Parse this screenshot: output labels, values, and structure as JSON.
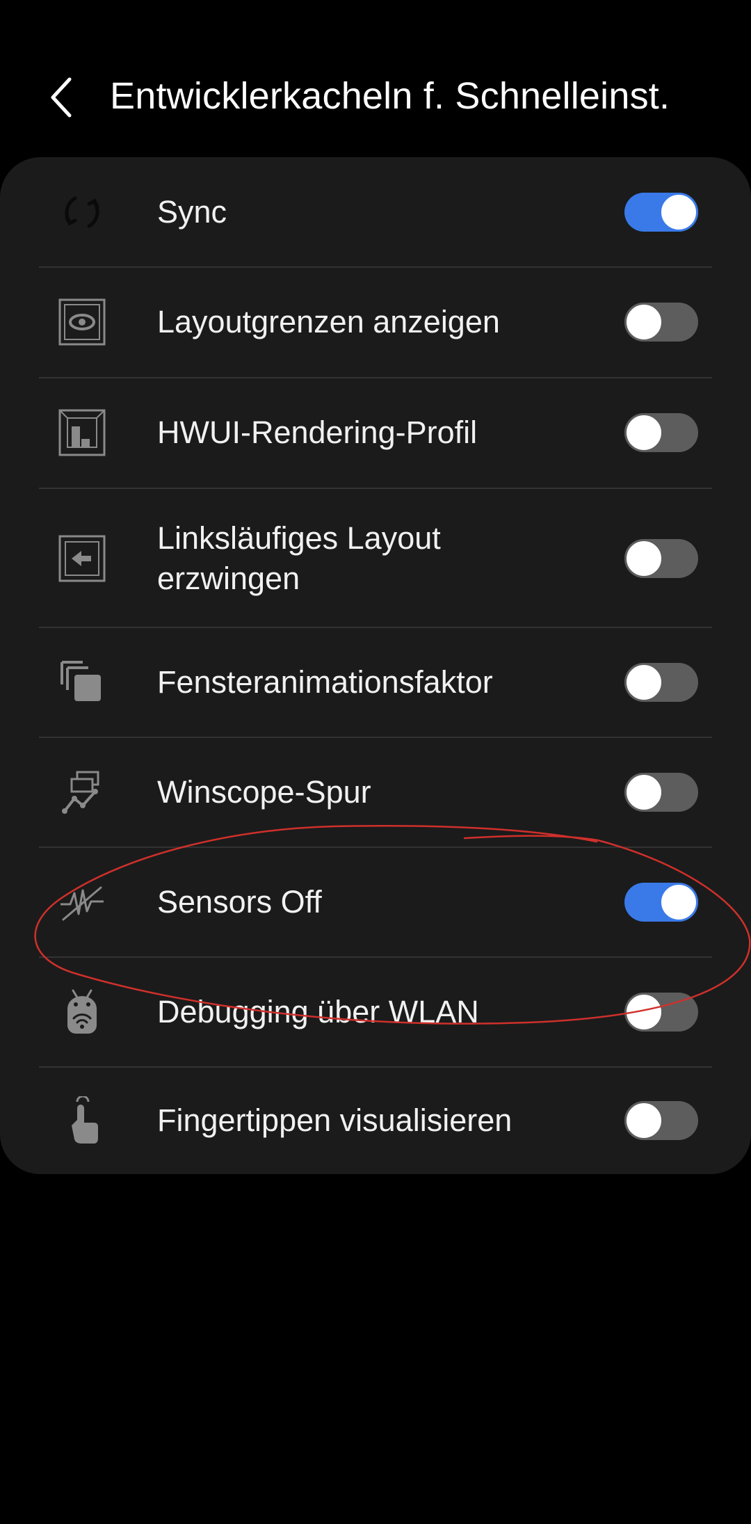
{
  "header": {
    "back_icon": "chevron-left-icon",
    "title": "Entwicklerkacheln f. Schnelleinst."
  },
  "colors": {
    "background": "#000000",
    "card": "#1b1b1b",
    "toggle_on": "#3a7ae8",
    "toggle_off": "#5d5d5d",
    "annotation": "#d0302b"
  },
  "tiles": [
    {
      "label": "Sync",
      "icon": "sync-icon",
      "enabled": true
    },
    {
      "label": "Layoutgrenzen anzeigen",
      "icon": "layout-bounds-icon",
      "enabled": false
    },
    {
      "label": "HWUI-Rendering-Profil",
      "icon": "hwui-profile-icon",
      "enabled": false
    },
    {
      "label": "Linksläufiges Layout erzwingen",
      "icon": "rtl-layout-icon",
      "enabled": false
    },
    {
      "label": "Fensteranimationsfaktor",
      "icon": "window-animation-icon",
      "enabled": false
    },
    {
      "label": "Winscope-Spur",
      "icon": "winscope-trace-icon",
      "enabled": false
    },
    {
      "label": "Sensors Off",
      "icon": "sensors-off-icon",
      "enabled": true
    },
    {
      "label": "Debugging über WLAN",
      "icon": "wifi-debugging-icon",
      "enabled": false
    },
    {
      "label": "Fingertippen visualisieren",
      "icon": "show-taps-icon",
      "enabled": false
    }
  ],
  "annotation": {
    "shape": "hand-drawn ellipse",
    "color": "#d0302b",
    "highlights": "Sensors Off"
  }
}
